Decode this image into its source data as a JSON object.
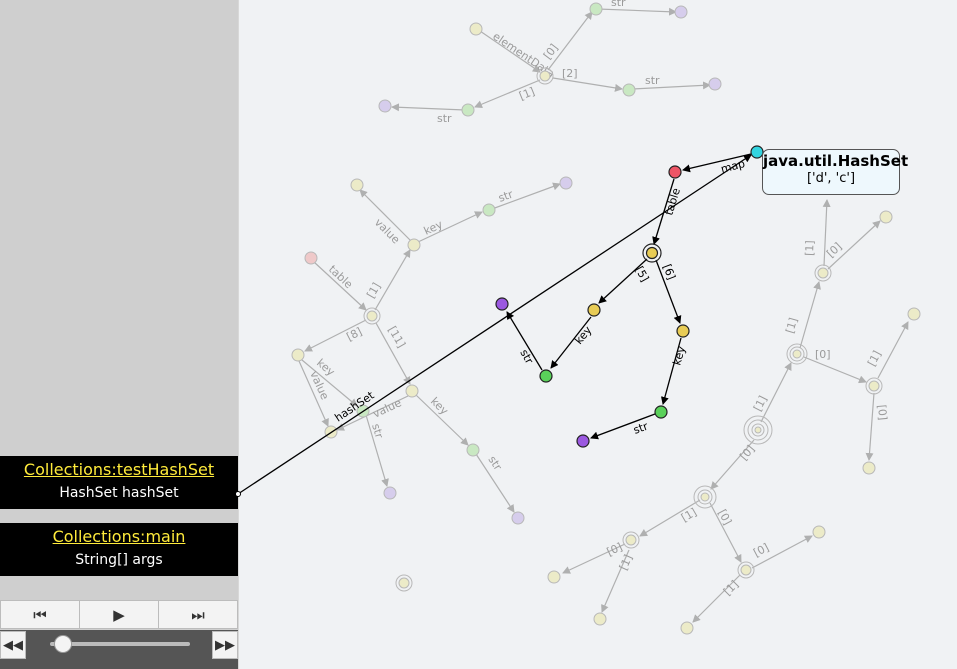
{
  "frames": [
    {
      "title": "Collections:testHashSet",
      "variables": [
        "HashSet hashSet"
      ]
    },
    {
      "title": "Collections:main",
      "variables": [
        "String[] args"
      ]
    }
  ],
  "controls": {
    "step_back_icon": "step-back-icon",
    "play_icon": "play-icon",
    "step_forward_icon": "step-forward-icon",
    "rewind_icon": "rewind-icon",
    "fast_forward_icon": "fast-forward-icon",
    "timeline_position": 0.09
  },
  "tooltip": {
    "type": "java.util.HashSet",
    "value": "['d', 'c']"
  },
  "graph": {
    "active_edge_labels": {
      "hashset": "hashSet",
      "map": "map",
      "table": "table",
      "idx5": "[5]",
      "idx6": "[6]",
      "key1": "key",
      "key2": "key",
      "str1": "str",
      "str2": "str"
    },
    "faded_edge_labels": {
      "elementData": "elementData",
      "e0": "[0]",
      "e1": "[1]",
      "e2": "[2]",
      "str_a": "str",
      "str_b": "str",
      "str_c": "str",
      "value1": "value",
      "key3": "key",
      "str_d": "str",
      "table2": "table",
      "e1b": "[1]",
      "e8": "[8]",
      "e11": "[11]",
      "key4": "key",
      "value2": "value",
      "str_e": "str",
      "value3": "value",
      "key5": "key",
      "str_f": "str",
      "t1a": "[1]",
      "t1b": "[1]",
      "t0a": "[0]",
      "t0b": "[0]",
      "t1c": "[1]",
      "t0c": "[0]",
      "t1d": "[1]",
      "t0d": "[0]",
      "t1e": "[1]",
      "t0e": "[0]",
      "t1f": "[1]",
      "t0f": "[0]",
      "t0g": "[0]",
      "t1g": "[1]",
      "t0h": "[0]",
      "t1h": "[1]"
    },
    "colors": {
      "string": "#9b59e0",
      "entry": "#e8cc55",
      "char": "#5ad15a",
      "map": "#ee5566",
      "set": "#33d4e0"
    }
  }
}
